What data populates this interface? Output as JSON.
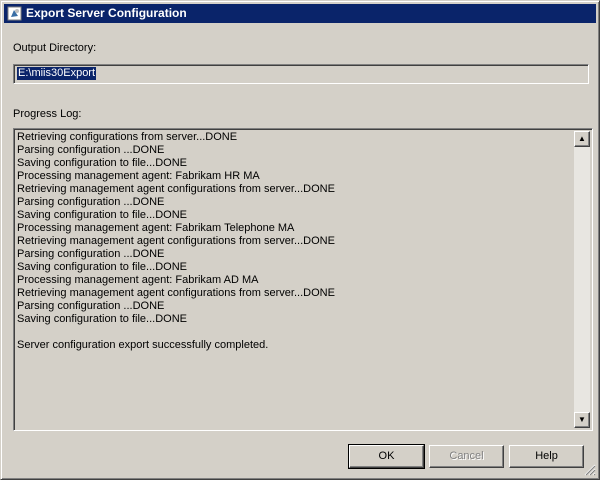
{
  "window": {
    "title": "Export Server Configuration",
    "icon": "app-icon"
  },
  "output_directory": {
    "label": "Output Directory:",
    "value": "E:\\miis30Export"
  },
  "progress_log": {
    "label": "Progress Log:",
    "lines": [
      "Retrieving configurations from server...DONE",
      "Parsing configuration ...DONE",
      "Saving configuration to file...DONE",
      "Processing management agent: Fabrikam HR MA",
      "Retrieving management agent configurations from server...DONE",
      "Parsing configuration ...DONE",
      "Saving configuration to file...DONE",
      "Processing management agent: Fabrikam Telephone MA",
      "Retrieving management agent configurations from server...DONE",
      "Parsing configuration ...DONE",
      "Saving configuration to file...DONE",
      "Processing management agent: Fabrikam AD MA",
      "Retrieving management agent configurations from server...DONE",
      "Parsing configuration ...DONE",
      "Saving configuration to file...DONE",
      "",
      "Server configuration export successfully completed."
    ]
  },
  "buttons": {
    "ok": "OK",
    "cancel": "Cancel",
    "help": "Help"
  },
  "colors": {
    "titlebar": "#0a246a",
    "face": "#d4d0c8"
  }
}
